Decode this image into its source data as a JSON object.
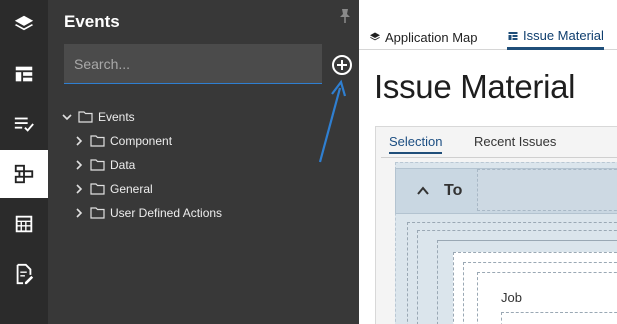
{
  "rail": {
    "items": [
      {
        "icon": "layers-icon"
      },
      {
        "icon": "layout-icon"
      },
      {
        "icon": "checklist-icon"
      },
      {
        "icon": "events-icon",
        "active": true
      },
      {
        "icon": "grid-calendar-icon"
      },
      {
        "icon": "edit-document-icon"
      }
    ]
  },
  "events_panel": {
    "title": "Events",
    "search_placeholder": "Search...",
    "tree": {
      "root": "Events",
      "children": [
        "Component",
        "Data",
        "General",
        "User Defined Actions"
      ]
    }
  },
  "tabs": [
    {
      "label": "Application Map",
      "icon": "layers-icon"
    },
    {
      "label": "Issue Material",
      "icon": "layout-icon",
      "active": true
    }
  ],
  "page": {
    "title": "Issue Material",
    "subtabs": [
      "Selection",
      "Recent Issues"
    ],
    "section_label": "To",
    "field_label": "Job"
  },
  "colors": {
    "rail_bg": "#2b2b2b",
    "panel_bg": "#383838",
    "accent": "#1f4e79",
    "arrow": "#2f7fd1"
  }
}
